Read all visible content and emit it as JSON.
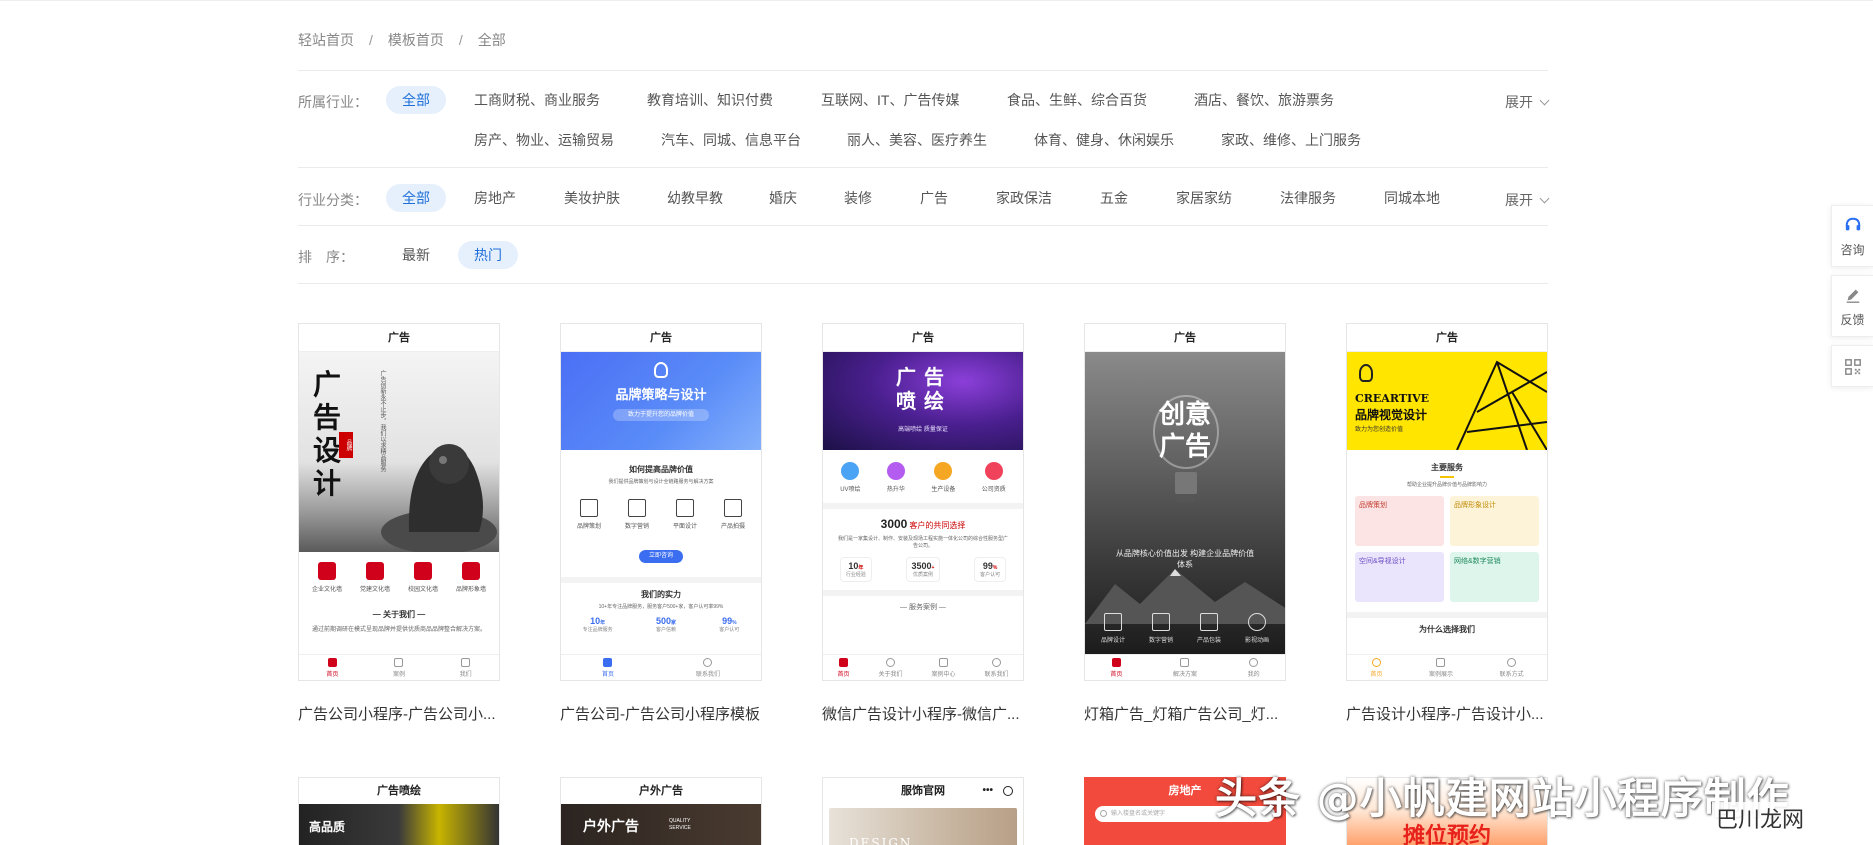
{
  "breadcrumb": [
    "轻站首页",
    "模板首页",
    "全部"
  ],
  "filters": {
    "industry": {
      "label": "所属行业：",
      "row1": [
        "全部",
        "工商财税、商业服务",
        "教育培训、知识付费",
        "互联网、IT、广告传媒",
        "食品、生鲜、综合百货",
        "酒店、餐饮、旅游票务"
      ],
      "row2": [
        "房产、物业、运输贸易",
        "汽车、同城、信息平台",
        "丽人、美容、医疗养生",
        "体育、健身、休闲娱乐",
        "家政、维修、上门服务"
      ],
      "expand": "展开"
    },
    "category": {
      "label": "行业分类：",
      "items": [
        "全部",
        "房地产",
        "美妆护肤",
        "幼教早教",
        "婚庆",
        "装修",
        "广告",
        "家政保洁",
        "五金",
        "家居家纺",
        "法律服务",
        "同城本地"
      ],
      "expand": "展开"
    },
    "sort": {
      "label": "排　序：",
      "items": [
        "最新",
        "热门"
      ]
    }
  },
  "cards": [
    {
      "header": "广告",
      "title": "广告公司小程序-广告公司小...",
      "banner_vertical": "广告设计",
      "banner_small": "广告创新永不止步，我们以求精品服务",
      "banner_seal": "品牌",
      "icons": [
        "企业文化墙",
        "党建文化墙",
        "校园文化墙",
        "品牌形象墙"
      ],
      "section": "— 关于我们 —",
      "section_text": "通过前期调研在模式呈现品牌并提供优质商品品牌整合解决方案。",
      "nav": [
        "首页",
        "案例",
        "我们"
      ]
    },
    {
      "header": "广告",
      "title": "广告公司-广告公司小程序模板",
      "banner_title": "品牌策略与设计",
      "banner_sub": "致力于提升您的品牌价值",
      "section": "如何提高品牌价值",
      "section_text": "我们提供品牌策划与设计全链路服务与解决方案",
      "icons": [
        "品牌策划",
        "数字营销",
        "平面设计",
        "产品拍摄"
      ],
      "cta": "立即咨询",
      "section2": "我们的实力",
      "section2_text": "10+年专注品牌服务，服务客户500+家，客户认可率99%",
      "stats": [
        [
          "10",
          "年",
          "专注品牌服务"
        ],
        [
          "500",
          "家",
          "客户信赖"
        ],
        [
          "99",
          "%",
          "客户认可"
        ]
      ],
      "nav": [
        "首页",
        "联系我们"
      ]
    },
    {
      "header": "广告",
      "title": "微信广告设计小程序-微信广...",
      "banner_title": [
        "广告",
        "喷绘"
      ],
      "banner_sub": "高端喷绘 质量保证",
      "icons": [
        "UV喷绘",
        "热升华",
        "生产设备",
        "公司资质"
      ],
      "headline_num": "3000",
      "headline_text": "客户的共同选择",
      "para": "我们是一家集设计、制作、安装及现场工程实施一体化公司的综合性服务型广告公司。",
      "stats": [
        [
          "10",
          "年",
          "行业经验"
        ],
        [
          "3500",
          "+",
          "优质案例"
        ],
        [
          "99",
          "%",
          "客户认可"
        ]
      ],
      "section": "— 服务案例 —",
      "nav": [
        "首页",
        "关于我们",
        "案例中心",
        "联系我们"
      ]
    },
    {
      "header": "广告",
      "title": "灯箱广告_灯箱广告公司_灯...",
      "banner_title": [
        "创意",
        "广告"
      ],
      "banner_sub": "从品牌核心价值出发 构建企业品牌价值体系",
      "icons": [
        "品牌设计",
        "数字营销",
        "产品包装",
        "影视动画"
      ],
      "nav": [
        "首页",
        "解决方案",
        "我的"
      ]
    },
    {
      "header": "广告",
      "title": "广告设计小程序-广告设计小...",
      "banner_en": "CREARTIVE",
      "banner_title": "品牌视觉设计",
      "banner_sub": "致力为您创造价值",
      "section": "主要服务",
      "section_text": "帮助企业提升品牌价值与品牌影响力",
      "services": [
        "品牌策划",
        "品牌形象设计",
        "空间&导视设计",
        "网络&数字营销"
      ],
      "section2": "为什么选择我们",
      "nav": [
        "首页",
        "案例展示",
        "联系方式"
      ]
    }
  ],
  "row2": [
    "广告喷绘",
    "户外广告",
    "服饰官网",
    "房地产",
    ""
  ],
  "row2_content": {
    "c1": "高品质",
    "c2": "户外广告",
    "c2_en": "QUALITY SERVICE",
    "c4_search": "输入楼盘名或关键字",
    "c5": "摊位预约",
    "c3_en": "DESIGN"
  },
  "sidebar": [
    "咨询",
    "反馈"
  ],
  "watermark": "头条 @小帆建网站小程序制作",
  "watermark2": "巴川龙网"
}
